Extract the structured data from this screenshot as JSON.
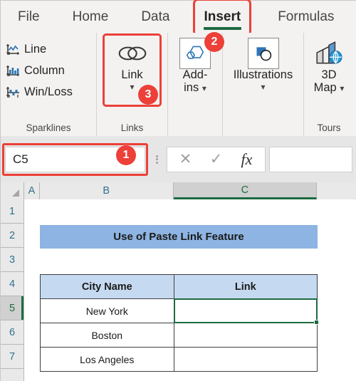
{
  "tabs": [
    {
      "label": "File",
      "active": false
    },
    {
      "label": "Home",
      "active": false
    },
    {
      "label": "Data",
      "active": false
    },
    {
      "label": "Insert",
      "active": true
    },
    {
      "label": "Formulas",
      "active": false
    }
  ],
  "ribbon": {
    "sparklines": {
      "group_label": "Sparklines",
      "items": [
        {
          "label": "Line",
          "icon": "sparkline-line-icon"
        },
        {
          "label": "Column",
          "icon": "sparkline-column-icon"
        },
        {
          "label": "Win/Loss",
          "icon": "sparkline-winloss-icon"
        }
      ]
    },
    "links": {
      "group_label": "Links",
      "button_label": "Link",
      "icon": "link-chain-icon"
    },
    "addins": {
      "group_label": "",
      "button_label_line1": "Add-",
      "button_label_line2": "ins",
      "icon": "addins-hexagon-icon"
    },
    "illustrations": {
      "group_label": "",
      "button_label": "Illustrations",
      "icon": "illustrations-shapes-icon"
    },
    "tours": {
      "group_label": "Tours",
      "button_label_line1": "3D",
      "button_label_line2": "Map",
      "icon": "3d-map-globe-icon"
    }
  },
  "formula_bar": {
    "name_box_value": "C5",
    "formula_value": "",
    "cancel_icon": "cancel-x-icon",
    "enter_icon": "enter-check-icon",
    "function_icon": "insert-function-fx-icon"
  },
  "markers": [
    {
      "number": "1",
      "target": "name-box"
    },
    {
      "number": "2",
      "target": "insert-tab"
    },
    {
      "number": "3",
      "target": "link-button"
    }
  ],
  "grid": {
    "columns": [
      {
        "label": "A",
        "selected": false
      },
      {
        "label": "B",
        "selected": false
      },
      {
        "label": "C",
        "selected": true
      }
    ],
    "rows": [
      "1",
      "2",
      "3",
      "4",
      "5",
      "6",
      "7"
    ],
    "selected_row": "5",
    "selected_cell": "C5",
    "title_banner": "Use of Paste Link Feature",
    "table": {
      "headers": [
        "City Name",
        "Link"
      ],
      "rows": [
        {
          "city": "New York",
          "link": ""
        },
        {
          "city": "Boston",
          "link": ""
        },
        {
          "city": "Los Angeles",
          "link": ""
        }
      ]
    }
  },
  "colors": {
    "accent_green": "#1d6b41",
    "callout_red": "#ec4038",
    "title_blue": "#8db4e2",
    "header_blue": "#c5d9f1"
  }
}
